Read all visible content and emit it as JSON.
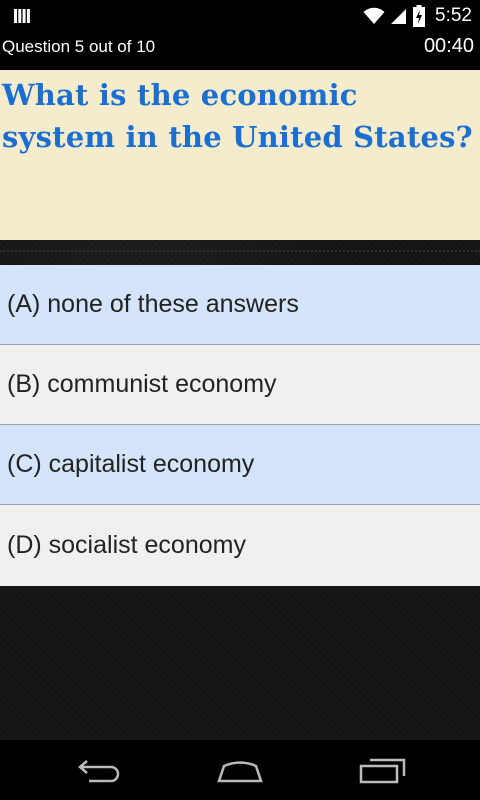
{
  "status_bar": {
    "time": "5:52",
    "icons": [
      "notification-bars-icon",
      "wifi-icon",
      "cell-signal-icon",
      "battery-charging-icon"
    ]
  },
  "quiz": {
    "progress": "Question 5 out of 10",
    "timer": "00:40",
    "question": "What is the economic system in the United States?",
    "question_color": "#1b6fd1",
    "answers": [
      {
        "label": "(A) none of these answers"
      },
      {
        "label": "(B) communist economy"
      },
      {
        "label": "(C) capitalist economy"
      },
      {
        "label": "(D) socialist economy"
      }
    ]
  },
  "nav_bar": {
    "icons": [
      "back-icon",
      "home-icon",
      "recent-apps-icon"
    ]
  }
}
